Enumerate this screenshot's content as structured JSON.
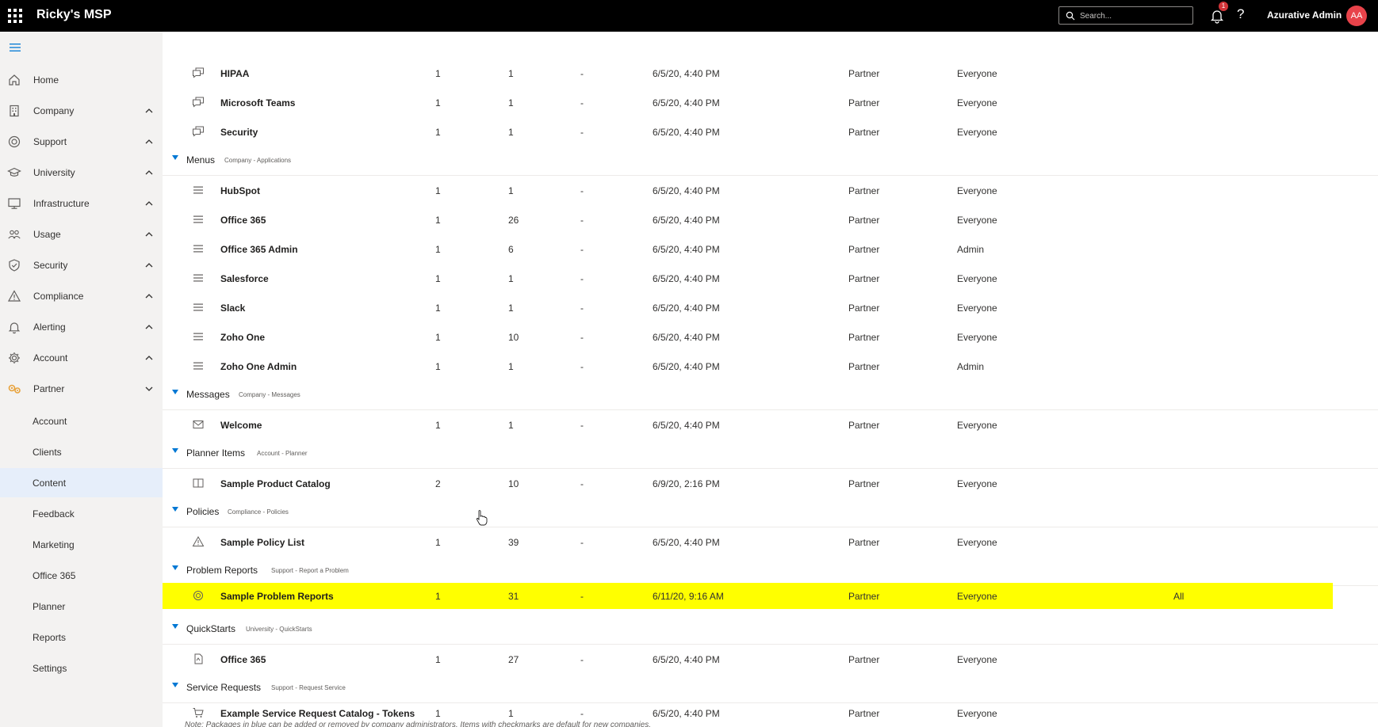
{
  "header": {
    "brand": "Ricky's MSP",
    "search_placeholder": "Search...",
    "notification_count": "1",
    "help_label": "?",
    "user_name": "Azurative Admin",
    "avatar_initials": "AA"
  },
  "sidebar": {
    "items": [
      {
        "label": "Home",
        "icon": "home-icon"
      },
      {
        "label": "Company",
        "icon": "building-icon"
      },
      {
        "label": "Support",
        "icon": "lifebuoy-icon"
      },
      {
        "label": "University",
        "icon": "graduation-cap-icon"
      },
      {
        "label": "Infrastructure",
        "icon": "monitor-icon"
      },
      {
        "label": "Usage",
        "icon": "people-icon"
      },
      {
        "label": "Security",
        "icon": "shield-icon"
      },
      {
        "label": "Compliance",
        "icon": "warning-icon"
      },
      {
        "label": "Alerting",
        "icon": "bell-icon"
      },
      {
        "label": "Account",
        "icon": "gear-icon"
      },
      {
        "label": "Partner",
        "icon": "partner-gears-icon"
      }
    ],
    "partner_sub": [
      {
        "label": "Account"
      },
      {
        "label": "Clients"
      },
      {
        "label": "Content"
      },
      {
        "label": "Feedback"
      },
      {
        "label": "Marketing"
      },
      {
        "label": "Office 365"
      },
      {
        "label": "Planner"
      },
      {
        "label": "Reports"
      },
      {
        "label": "Settings"
      }
    ],
    "active_sub": "Content",
    "accent_color": "#e8a33d"
  },
  "content": {
    "rows_top": [
      {
        "name": "HIPAA",
        "a": "1",
        "b": "1",
        "dash": "-",
        "date": "6/5/20, 4:40 PM",
        "by": "Partner",
        "audience": "Everyone"
      },
      {
        "name": "Microsoft Teams",
        "a": "1",
        "b": "1",
        "dash": "-",
        "date": "6/5/20, 4:40 PM",
        "by": "Partner",
        "audience": "Everyone"
      },
      {
        "name": "Security",
        "a": "1",
        "b": "1",
        "dash": "-",
        "date": "6/5/20, 4:40 PM",
        "by": "Partner",
        "audience": "Everyone"
      }
    ],
    "groups": [
      {
        "name": "Menus",
        "sub": "Company - Applications"
      },
      {
        "name": "Messages",
        "sub": "Company - Messages"
      },
      {
        "name": "Planner Items",
        "sub": "Account - Planner"
      },
      {
        "name": "Policies",
        "sub": "Compliance - Policies"
      },
      {
        "name": "Problem Reports",
        "sub": "Support - Report a Problem"
      },
      {
        "name": "QuickStarts",
        "sub": "University - QuickStarts"
      },
      {
        "name": "Service Requests",
        "sub": "Support - Request Service"
      }
    ],
    "menus": [
      {
        "name": "HubSpot",
        "a": "1",
        "b": "1",
        "dash": "-",
        "date": "6/5/20, 4:40 PM",
        "by": "Partner",
        "audience": "Everyone"
      },
      {
        "name": "Office 365",
        "a": "1",
        "b": "26",
        "dash": "-",
        "date": "6/5/20, 4:40 PM",
        "by": "Partner",
        "audience": "Everyone"
      },
      {
        "name": "Office 365 Admin",
        "a": "1",
        "b": "6",
        "dash": "-",
        "date": "6/5/20, 4:40 PM",
        "by": "Partner",
        "audience": "Admin"
      },
      {
        "name": "Salesforce",
        "a": "1",
        "b": "1",
        "dash": "-",
        "date": "6/5/20, 4:40 PM",
        "by": "Partner",
        "audience": "Everyone"
      },
      {
        "name": "Slack",
        "a": "1",
        "b": "1",
        "dash": "-",
        "date": "6/5/20, 4:40 PM",
        "by": "Partner",
        "audience": "Everyone"
      },
      {
        "name": "Zoho One",
        "a": "1",
        "b": "10",
        "dash": "-",
        "date": "6/5/20, 4:40 PM",
        "by": "Partner",
        "audience": "Everyone"
      },
      {
        "name": "Zoho One Admin",
        "a": "1",
        "b": "1",
        "dash": "-",
        "date": "6/5/20, 4:40 PM",
        "by": "Partner",
        "audience": "Admin"
      }
    ],
    "messages": [
      {
        "name": "Welcome",
        "a": "1",
        "b": "1",
        "dash": "-",
        "date": "6/5/20, 4:40 PM",
        "by": "Partner",
        "audience": "Everyone"
      }
    ],
    "planner": [
      {
        "name": "Sample Product Catalog",
        "a": "2",
        "b": "10",
        "dash": "-",
        "date": "6/9/20, 2:16 PM",
        "by": "Partner",
        "audience": "Everyone"
      }
    ],
    "policies": [
      {
        "name": "Sample Policy List",
        "a": "1",
        "b": "39",
        "dash": "-",
        "date": "6/5/20, 4:40 PM",
        "by": "Partner",
        "audience": "Everyone"
      }
    ],
    "problem_reports": [
      {
        "name": "Sample Problem Reports",
        "a": "1",
        "b": "31",
        "dash": "-",
        "date": "6/11/20, 9:16 AM",
        "by": "Partner",
        "audience": "Everyone",
        "extra": "All"
      }
    ],
    "quickstarts": [
      {
        "name": "Office 365",
        "a": "1",
        "b": "27",
        "dash": "-",
        "date": "6/5/20, 4:40 PM",
        "by": "Partner",
        "audience": "Everyone"
      }
    ],
    "service_requests": [
      {
        "name": "Example Service Request Catalog - Tokens",
        "a": "1",
        "b": "1",
        "dash": "-",
        "date": "6/5/20, 4:40 PM",
        "by": "Partner",
        "audience": "Everyone"
      }
    ],
    "note": "Note: Packages in blue can be added or removed by company administrators. Items with checkmarks are default for new companies.",
    "highlight_color": "#ffff00"
  }
}
